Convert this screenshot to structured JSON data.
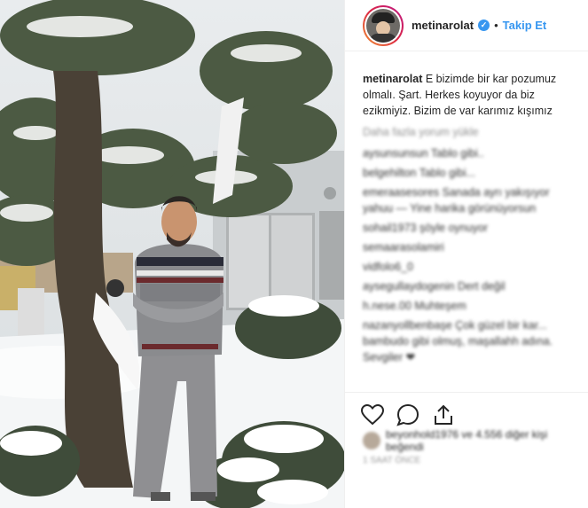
{
  "post": {
    "username": "metinarolat",
    "verified_mark": "✓",
    "separator": "•",
    "follow_label": "Takip Et",
    "caption": "E bizimde bir kar pozumuz olmalı. Şart. Herkes koyuyor da biz ezikmiyiz. Bizim de var karımız kışımız",
    "load_more": "Daha fazla yorum yükle",
    "comments": [
      "aysunsunsun Tablo gibi..",
      "belgehilton Tablo gibi...",
      "emeraasesores Sanada ayrı yakışıyor yahuu — Yine harika görünüyorsun",
      "sohail1973 şöyle oynuyor",
      "semaarasolamiri",
      "vidfolo6_0",
      "aysegullaydogenin Dert değil",
      "h.nese.00 Muhteşem",
      "nazanyollbenbaşe Çok güzel bir kar... bambudo gibi olmuş, maşallahh adına. Sevgiler ❤"
    ],
    "likes_text": "beyonhold1976 ve 4.556 diğer kişi beğendi",
    "time_text": "1 SAAT ÖNCE"
  },
  "icons": [
    "heart-icon",
    "comment-icon",
    "share-icon"
  ]
}
